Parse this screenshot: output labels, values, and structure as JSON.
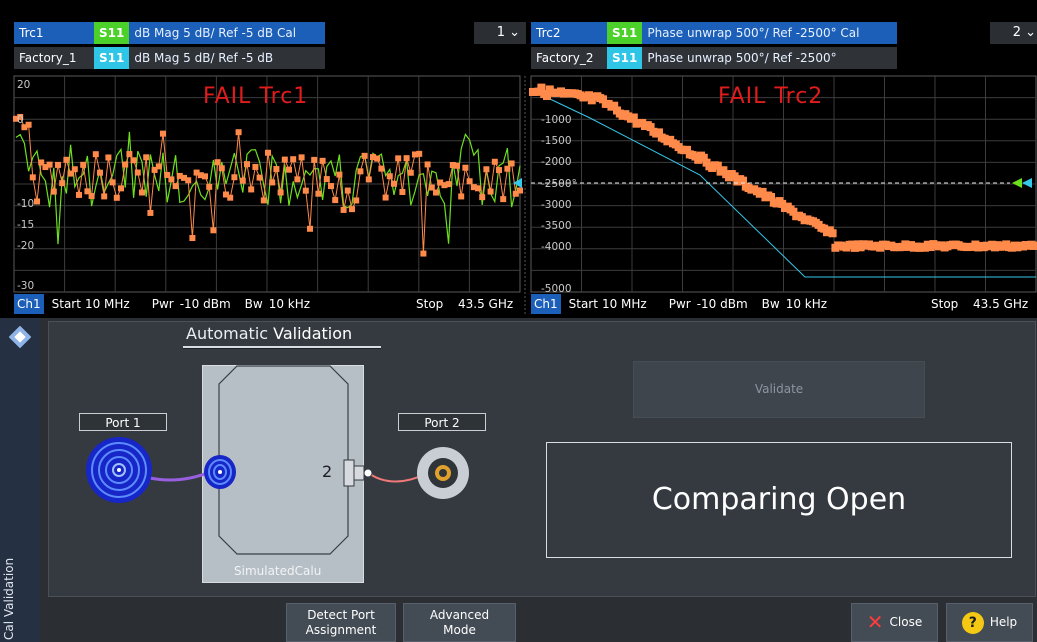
{
  "trace1": {
    "header_main": {
      "name": "Trc1",
      "sparam": "S11",
      "text": "dB Mag  5 dB/ Ref -5 dB  Cal"
    },
    "header_ref": {
      "name": "Factory_1",
      "sparam": "S11",
      "text": "dB Mag  5 dB/ Ref -5 dB"
    },
    "selector": "1 ⌄",
    "fail": "FAIL  Trc1",
    "y_ticks": [
      "20",
      "0",
      "-10",
      "-15",
      "-20",
      "-30"
    ],
    "channel": {
      "ch": "Ch1",
      "start_label": "Start",
      "start_val": "10 MHz",
      "pwr_label": "Pwr",
      "pwr_val": "-10 dBm",
      "bw_label": "Bw",
      "bw_val": "10 kHz",
      "stop_label": "Stop",
      "stop_val": "43.5 GHz"
    }
  },
  "trace2": {
    "header_main": {
      "name": "Trc2",
      "sparam": "S11",
      "text": "Phase unwrap  500°/ Ref -2500°  Cal"
    },
    "header_ref": {
      "name": "Factory_2",
      "sparam": "S11",
      "text": "Phase unwrap  500°/ Ref -2500°"
    },
    "selector": "2 ⌄",
    "fail": "FAIL  Trc2",
    "y_ticks": [
      "-1000",
      "-1500",
      "-2000",
      "-2500°",
      "-3000",
      "-3500",
      "-4000",
      "-5000"
    ],
    "channel": {
      "ch": "Ch1",
      "start_label": "Start",
      "start_val": "10 MHz",
      "pwr_label": "Pwr",
      "pwr_val": "-10 dBm",
      "bw_label": "Bw",
      "bw_val": "10 kHz",
      "stop_label": "Stop",
      "stop_val": "43.5 GHz"
    }
  },
  "panel": {
    "title_light": "Automatic ",
    "title_bold": "Validation",
    "port1": "Port 1",
    "port2": "Port 2",
    "device_port_number": "2",
    "device_label": "SimulatedCalu",
    "validate_label": "Validate",
    "status": "Comparing Open",
    "detect_line1": "Detect Port",
    "detect_line2": "Assignment",
    "advanced_line1": "Advanced",
    "advanced_line2": "Mode",
    "close_label": "Close",
    "help_label": "Help",
    "side_label": "Cal Validation"
  },
  "colors": {
    "meas": "#ff8a4a",
    "ref1": "#6de01e",
    "ref2": "#34c8ea",
    "fail": "#e21c1c",
    "header": "#1c5fb8"
  }
}
